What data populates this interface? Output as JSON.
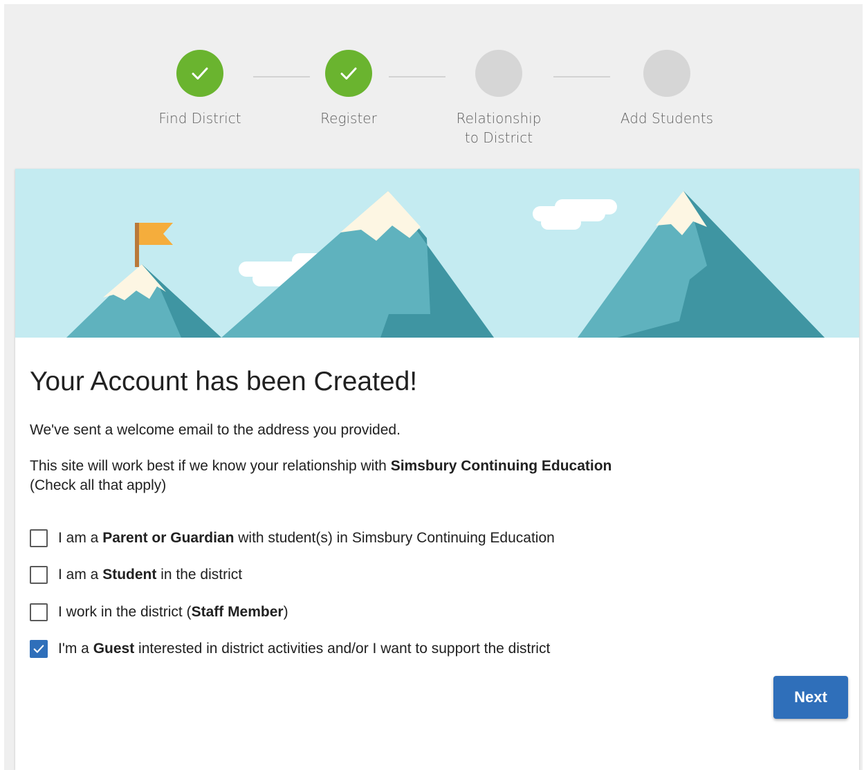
{
  "stepper": {
    "steps": [
      {
        "label": "Find District",
        "state": "done"
      },
      {
        "label": "Register",
        "state": "done"
      },
      {
        "label_line1": "Relationship",
        "label_line2": "to District",
        "state": "pending"
      },
      {
        "label": "Add Students",
        "state": "pending"
      }
    ],
    "done_color": "#6ab42f",
    "pending_color": "#d6d6d6"
  },
  "main": {
    "title": "Your Account has been Created!",
    "welcome_text": "We've sent a welcome email to the address you provided.",
    "relationship_prefix": "This site will work best if we know your relationship with ",
    "district_name": "Simsbury Continuing Education",
    "check_all": "(Check all that apply)",
    "options": [
      {
        "pre": "I am a ",
        "bold": "Parent or Guardian",
        "post": " with student(s) in Simsbury Continuing Education",
        "checked": false
      },
      {
        "pre": "I am a ",
        "bold": "Student",
        "post": " in the district",
        "checked": false
      },
      {
        "pre": "I work in the district (",
        "bold": "Staff Member",
        "post": ")",
        "checked": false
      },
      {
        "pre": "I'm a ",
        "bold": "Guest",
        "post": " interested in district activities and/or I want to support the district",
        "checked": true
      }
    ],
    "next_label": "Next"
  },
  "colors": {
    "primary": "#2f6fba",
    "sky": "#c4ebf1",
    "mountain": "#5fb2be",
    "mountain_shade": "#3f95a2",
    "flag": "#f5ad3c"
  },
  "icons": {
    "step_done": "check-icon",
    "checkbox_checked": "check-icon"
  }
}
